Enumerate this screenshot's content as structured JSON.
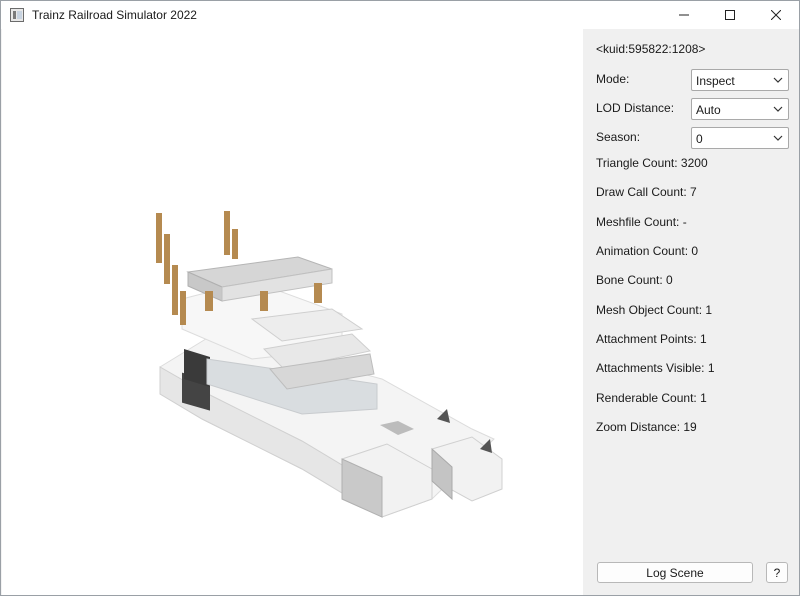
{
  "window": {
    "title": "Trainz Railroad Simulator 2022",
    "controls": [
      "minimize",
      "maximize",
      "close"
    ]
  },
  "viewport": {
    "content": "3D model preview of white and grey block boat with wooden masts"
  },
  "panel": {
    "kuid": "<kuid:595822:1208>",
    "mode": {
      "label": "Mode:",
      "value": "Inspect"
    },
    "lod": {
      "label": "LOD Distance:",
      "value": "Auto"
    },
    "season": {
      "label": "Season:",
      "value": "0"
    },
    "stats": [
      "Triangle Count: 3200",
      "Draw Call Count: 7",
      "Meshfile Count: -",
      "Animation Count: 0",
      "Bone Count: 0",
      "Mesh Object Count: 1",
      "Attachment Points: 1",
      "Attachments Visible: 1",
      "Renderable Count: 1",
      "Zoom Distance: 19"
    ],
    "log_button": "Log Scene",
    "help_button": "?"
  }
}
